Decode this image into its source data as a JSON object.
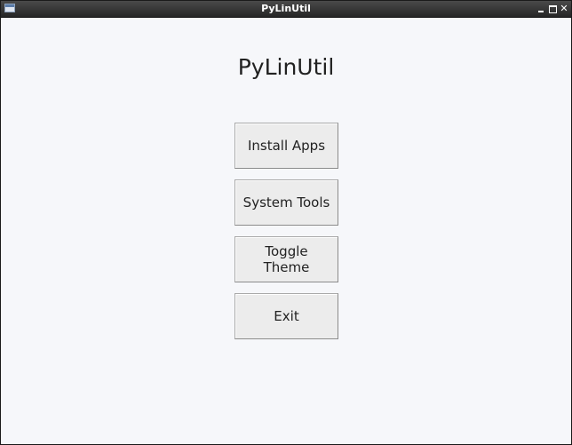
{
  "window": {
    "title": "PyLinUtil",
    "controls": [
      "minimize-icon",
      "maximize-icon",
      "close-icon"
    ]
  },
  "main": {
    "heading": "PyLinUtil",
    "buttons": [
      {
        "label": "Install Apps"
      },
      {
        "label": "System Tools"
      },
      {
        "label": "Toggle Theme"
      },
      {
        "label": "Exit"
      }
    ]
  },
  "colors": {
    "background": "#f6f7fa",
    "titlebar": "#333333",
    "button_face": "#ececec",
    "text": "#222222"
  }
}
